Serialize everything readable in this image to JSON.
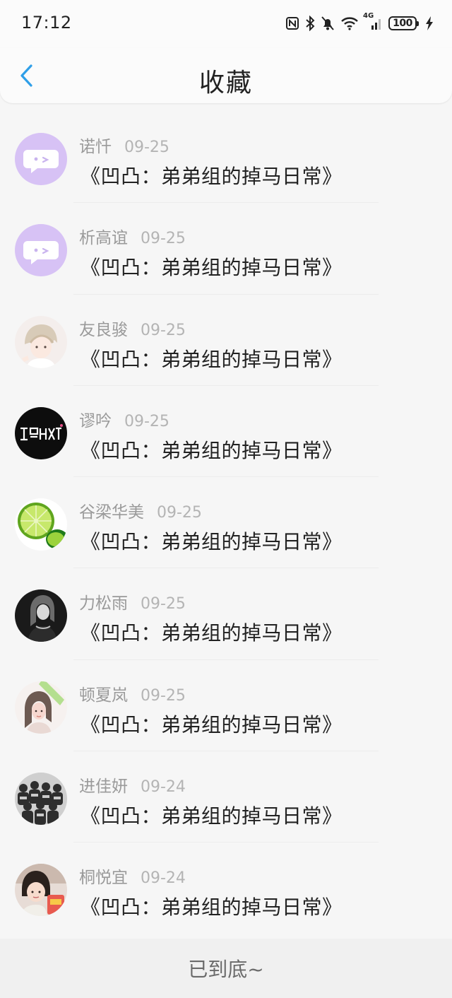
{
  "status_bar": {
    "time": "17:12",
    "battery": "100",
    "signal_label": "4G",
    "icons": [
      "nfc-icon",
      "bluetooth-icon",
      "bell-off-icon",
      "wifi-icon",
      "signal-icon",
      "battery-icon",
      "charging-icon"
    ]
  },
  "header": {
    "title": "收藏",
    "back_icon": "chevron-left-icon"
  },
  "items": [
    {
      "name": "诺忏",
      "date": "09-25",
      "title": "《凹凸：弟弟组的掉马日常》",
      "avatar": "default-chat-avatar"
    },
    {
      "name": "析高谊",
      "date": "09-25",
      "title": "《凹凸：弟弟组的掉马日常》",
      "avatar": "default-chat-avatar"
    },
    {
      "name": "友良骏",
      "date": "09-25",
      "title": "《凹凸：弟弟组的掉马日常》",
      "avatar": "anime-boy-avatar"
    },
    {
      "name": "谬吟",
      "date": "09-25",
      "title": "《凹凸：弟弟组的掉马日常》",
      "avatar": "black-logo-avatar"
    },
    {
      "name": "谷梁华美",
      "date": "09-25",
      "title": "《凹凸：弟弟组的掉马日常》",
      "avatar": "lime-avatar"
    },
    {
      "name": "力松雨",
      "date": "09-25",
      "title": "《凹凸：弟弟组的掉马日常》",
      "avatar": "dark-portrait-avatar"
    },
    {
      "name": "顿夏岚",
      "date": "09-25",
      "title": "《凹凸：弟弟组的掉马日常》",
      "avatar": "girl-green-avatar"
    },
    {
      "name": "进佳妍",
      "date": "09-24",
      "title": "《凹凸：弟弟组的掉马日常》",
      "avatar": "group-photo-avatar"
    },
    {
      "name": "桐悦宜",
      "date": "09-24",
      "title": "《凹凸：弟弟组的掉马日常》",
      "avatar": "child-photo-avatar"
    }
  ],
  "footer": {
    "end_text": "已到底~"
  },
  "colors": {
    "accent": "#2f9fe8",
    "default_avatar_bg": "#d7c2f5",
    "name_gray": "#9a9a9a",
    "date_gray": "#b4b4b4"
  }
}
